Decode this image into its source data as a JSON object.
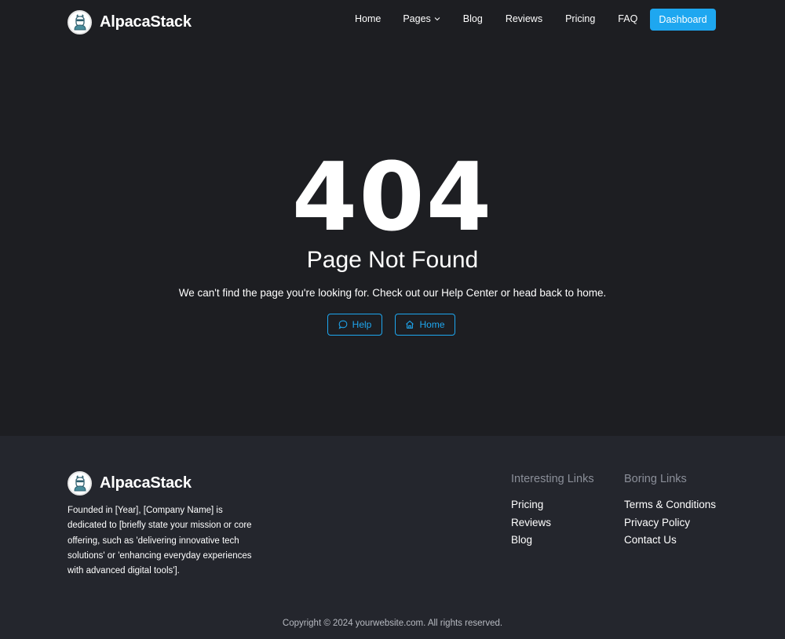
{
  "brand": {
    "name": "AlpacaStack",
    "logo_icon": "alpaca-logo-icon"
  },
  "nav": {
    "items": [
      {
        "label": "Home"
      },
      {
        "label": "Pages",
        "icon": "chevron-down-icon"
      },
      {
        "label": "Blog"
      },
      {
        "label": "Reviews"
      },
      {
        "label": "Pricing"
      },
      {
        "label": "FAQ"
      }
    ],
    "dashboard_label": "Dashboard"
  },
  "error": {
    "code": "404",
    "title": "Page Not Found",
    "message": "We can't find the page you're looking for. Check out our Help Center or head back to home.",
    "help_label": "Help",
    "help_icon": "chat-bubble-icon",
    "home_label": "Home",
    "home_icon": "house-icon"
  },
  "footer": {
    "brand_name": "AlpacaStack",
    "about": "Founded in [Year], [Company Name] is dedicated to [briefly state your mission or core offering, such as 'delivering innovative tech solutions' or 'enhancing everyday experiences with advanced digital tools'].",
    "interesting": {
      "title": "Interesting Links",
      "links": [
        "Pricing",
        "Reviews",
        "Blog"
      ]
    },
    "boring": {
      "title": "Boring Links",
      "links": [
        "Terms & Conditions",
        "Privacy Policy",
        "Contact Us"
      ]
    },
    "copyright": "Copyright © 2024 yourwebsite.com. All rights reserved."
  },
  "colors": {
    "background": "#1d1e22",
    "footer_background": "#24262d",
    "accent": "#1ea7f0",
    "muted_text": "#8b8f99"
  }
}
